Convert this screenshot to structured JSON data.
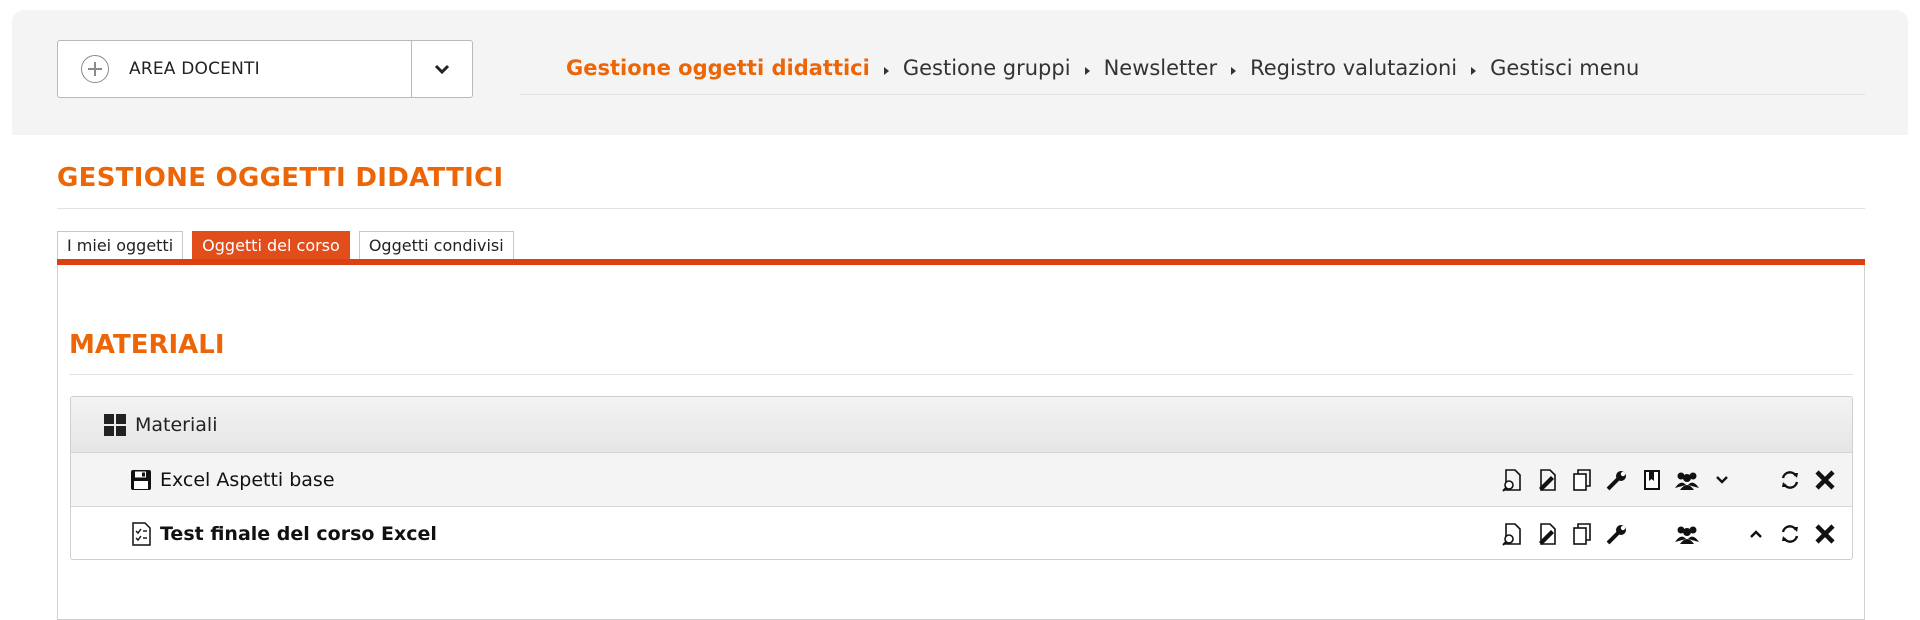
{
  "header": {
    "area_label": "AREA DOCENTI",
    "nav": [
      {
        "label": "Gestione oggetti didattici",
        "active": true
      },
      {
        "label": "Gestione gruppi",
        "active": false
      },
      {
        "label": "Newsletter",
        "active": false
      },
      {
        "label": "Registro valutazioni",
        "active": false
      },
      {
        "label": "Gestisci menu",
        "active": false
      }
    ]
  },
  "page": {
    "title": "GESTIONE OGGETTI DIDATTICI",
    "tabs": [
      {
        "label": "I miei oggetti",
        "active": false
      },
      {
        "label": "Oggetti del corso",
        "active": true
      },
      {
        "label": "Oggetti condivisi",
        "active": false
      }
    ]
  },
  "section": {
    "title": "MATERIALI",
    "folder": {
      "label": "Materiali",
      "icon": "grid-icon"
    },
    "items": [
      {
        "label": "Excel Aspetti base",
        "icon": "floppy-disk-icon",
        "bold": false
      },
      {
        "label": "Test finale del corso Excel",
        "icon": "checklist-icon",
        "bold": true
      }
    ]
  },
  "colors": {
    "accent": "#ec6608",
    "tab_active": "#e24e1b",
    "tab_rule": "#dc3f12"
  }
}
